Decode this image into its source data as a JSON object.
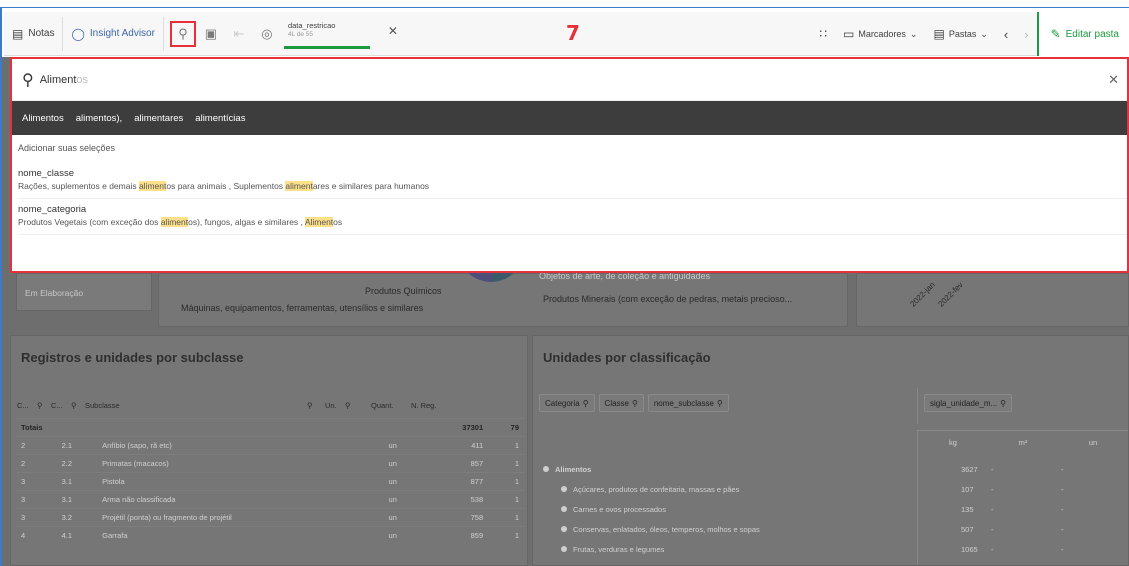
{
  "toolbar": {
    "notes_label": "Notas",
    "insight_label": "Insight Advisor",
    "selection_field": "data_restricao",
    "selection_sub": "4L de 55",
    "step_marker": "7",
    "bookmarks_label": "Marcadores",
    "sheets_label": "Pastas",
    "edit_label": "Editar pasta"
  },
  "search": {
    "query_typed": "Aliment",
    "query_ghost": "os",
    "suggestions": [
      "Alimentos",
      "alimentos),",
      "alimentares",
      "alimentícias"
    ],
    "add_selections": "Adicionar suas seleções",
    "groups": [
      {
        "field": "nome_classe",
        "parts": [
          "Rações, suplementos e demais ",
          "aliment",
          "os para animais , Suplementos ",
          "aliment",
          "ares e similares para humanos"
        ]
      },
      {
        "field": "nome_categoria",
        "parts": [
          "Produtos Vegetais (com exceção dos ",
          "aliment",
          "os), fungos, algas e similares , ",
          "Aliment",
          "os"
        ]
      }
    ]
  },
  "background": {
    "status_label": "Em Elaboração",
    "pie_labels": [
      "Produtos Químicos",
      "Máquinas, equipamentos, ferramentas, utensílios e similares",
      "Objetos de arte, de coleção e antiguidades",
      "Produtos Minerais (com exceção de pedras, metais precioso..."
    ],
    "axis_labels": [
      "2022-jan",
      "2022-fev"
    ],
    "left_panel": {
      "title": "Registros e unidades por subclasse",
      "headers": [
        "C...",
        "C...",
        "Subclasse",
        "Un.",
        "Quant.",
        "N. Reg."
      ],
      "totals": [
        "Totais",
        "",
        "",
        "",
        "37301",
        "79"
      ],
      "rows": [
        [
          "2",
          "2.1",
          "Anfíbio (sapo, rã etc)",
          "un",
          "411",
          "1"
        ],
        [
          "2",
          "2.2",
          "Primatas (macacos)",
          "un",
          "857",
          "1"
        ],
        [
          "3",
          "3.1",
          "Pistola",
          "un",
          "877",
          "1"
        ],
        [
          "3",
          "3.1",
          "Arma não classificada",
          "un",
          "538",
          "1"
        ],
        [
          "3",
          "3.2",
          "Projétil (ponta) ou fragmento de projétil",
          "un",
          "758",
          "1"
        ],
        [
          "4",
          "4.1",
          "Garrafa",
          "un",
          "859",
          "1"
        ]
      ]
    },
    "right_panel": {
      "title": "Unidades por classificação",
      "filters": [
        "Categoria",
        "Classe",
        "nome_subclasse"
      ],
      "unit_filter": "sigla_unidade_m...",
      "unit_headers": [
        "kg",
        "m²",
        "un"
      ],
      "rows": [
        {
          "label": "Alimentos",
          "kg": "3627",
          "m2": "-",
          "un": "-",
          "level": 0
        },
        {
          "label": "Açúcares, produtos de confeitaria, massas e pães",
          "kg": "107",
          "m2": "-",
          "un": "-",
          "level": 1
        },
        {
          "label": "Carnes e ovos processados",
          "kg": "135",
          "m2": "-",
          "un": "-",
          "level": 1
        },
        {
          "label": "Conservas, enlatados, óleos, temperos, molhos e sopas",
          "kg": "507",
          "m2": "-",
          "un": "-",
          "level": 1
        },
        {
          "label": "Frutas, verduras e legumes",
          "kg": "1065",
          "m2": "-",
          "un": "-",
          "level": 1
        }
      ]
    }
  }
}
